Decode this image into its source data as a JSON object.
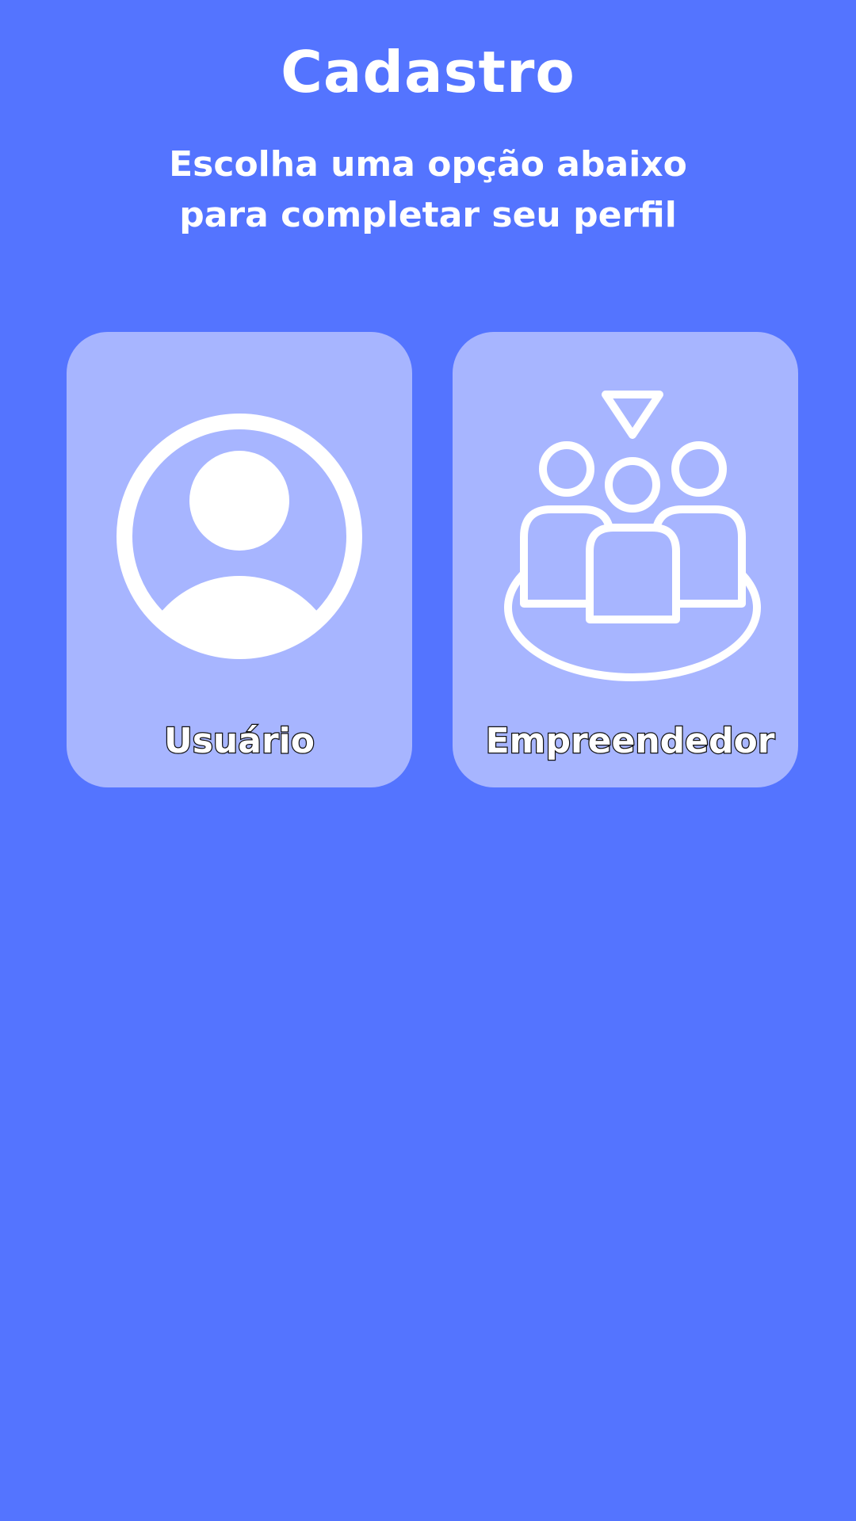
{
  "header": {
    "title": "Cadastro",
    "subtitle_line1": "Escolha uma opção abaixo",
    "subtitle_line2": "para completar seu perfil"
  },
  "options": [
    {
      "label": "Usuário",
      "icon": "user-profile-icon"
    },
    {
      "label": "Empreendedor",
      "icon": "group-meeting-icon"
    }
  ],
  "colors": {
    "background": "#5474FF",
    "card": "#A7B5FF",
    "text": "#FFFFFF",
    "label_outline": "#111111"
  }
}
